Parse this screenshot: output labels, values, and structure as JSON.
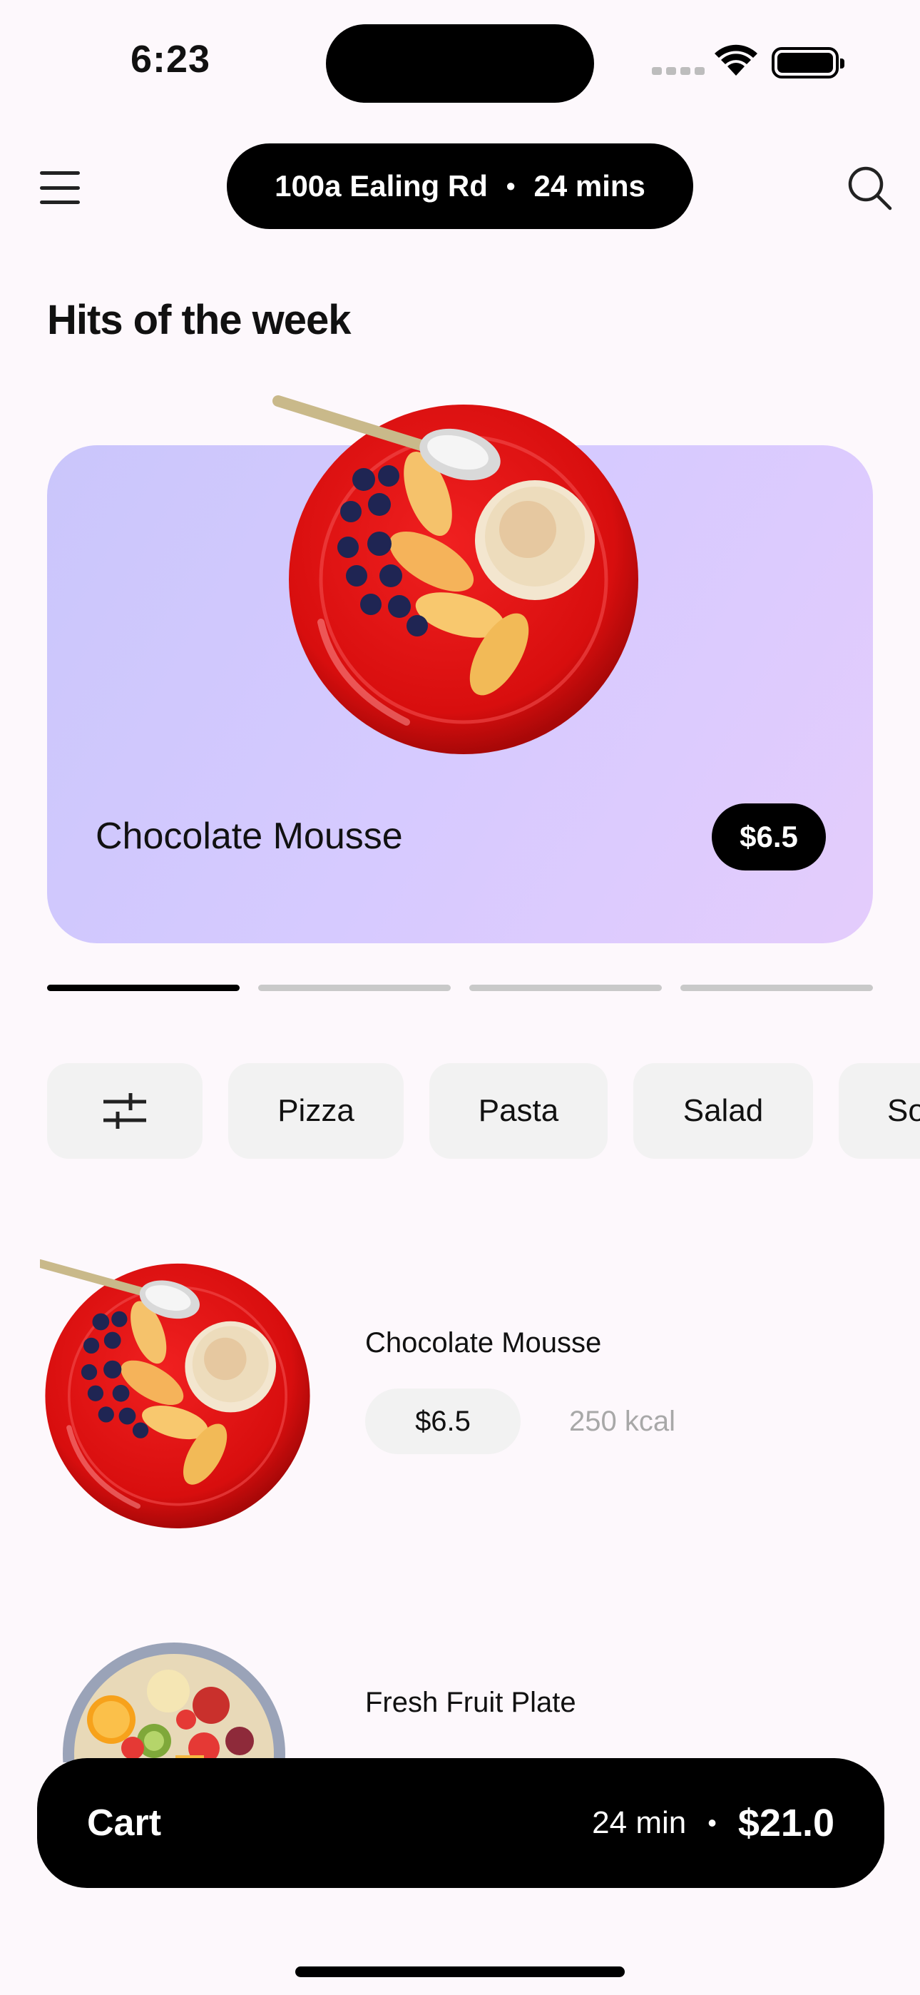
{
  "status_bar": {
    "time": "6:23"
  },
  "header": {
    "location": "100a Ealing Rd",
    "separator": "•",
    "eta": "24 mins",
    "menu_icon": "hamburger-menu-icon",
    "search_icon": "search-icon"
  },
  "hits": {
    "title": "Hits of the week",
    "featured": {
      "name": "Chocolate Mousse",
      "price": "$6.5"
    },
    "pager": {
      "count": 4,
      "active_index": 0
    }
  },
  "categories": {
    "filter_icon": "sliders-icon",
    "items": [
      "Pizza",
      "Pasta",
      "Salad",
      "So"
    ]
  },
  "products": [
    {
      "name": "Chocolate Mousse",
      "price": "$6.5",
      "kcal": "250 kcal"
    },
    {
      "name": "Fresh Fruit Plate"
    }
  ],
  "cart": {
    "label": "Cart",
    "time": "24 min",
    "separator": "•",
    "total": "$21.0"
  },
  "colors": {
    "background": "#fdf8fc",
    "hero_gradient_start": "#cac6fb",
    "hero_gradient_end": "#e4ccfc",
    "chip": "#f2f2f2",
    "plate_red": "#e11414"
  }
}
